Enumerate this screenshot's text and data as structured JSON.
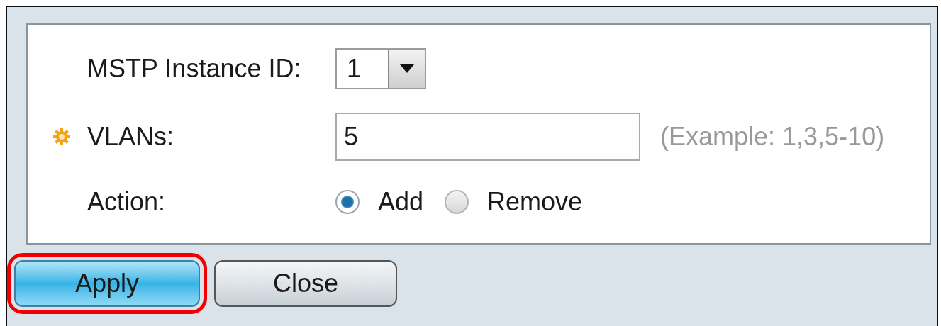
{
  "form": {
    "instance": {
      "label": "MSTP Instance ID:",
      "value": "1"
    },
    "vlans": {
      "label": "VLANs:",
      "required": true,
      "value": "5",
      "hint": "(Example: 1,3,5-10)"
    },
    "action": {
      "label": "Action:",
      "options": [
        {
          "label": "Add",
          "selected": true
        },
        {
          "label": "Remove",
          "selected": false
        }
      ]
    }
  },
  "buttons": [
    {
      "label": "Apply",
      "kind": "primary",
      "highlighted": true
    },
    {
      "label": "Close",
      "kind": "secondary",
      "highlighted": false
    }
  ]
}
